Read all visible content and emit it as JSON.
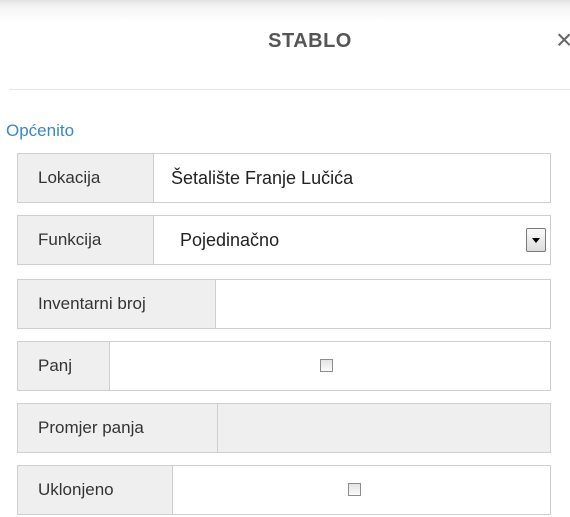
{
  "header": {
    "title": "STABLO",
    "close_glyph": "×"
  },
  "section": {
    "title": "Općenito"
  },
  "fields": {
    "lokacija": {
      "label": "Lokacija",
      "value": "Šetalište Franje Lučića"
    },
    "funkcija": {
      "label": "Funkcija",
      "value": "Pojedinačno"
    },
    "inventarni_broj": {
      "label": "Inventarni broj",
      "value": ""
    },
    "panj": {
      "label": "Panj",
      "checked": false
    },
    "promjer_panja": {
      "label": "Promjer panja",
      "value": ""
    },
    "uklonjeno": {
      "label": "Uklonjeno",
      "checked": false
    }
  },
  "colors": {
    "section_title": "#3a87c8",
    "label_bg": "#efefef",
    "border": "#cfcfcf"
  }
}
